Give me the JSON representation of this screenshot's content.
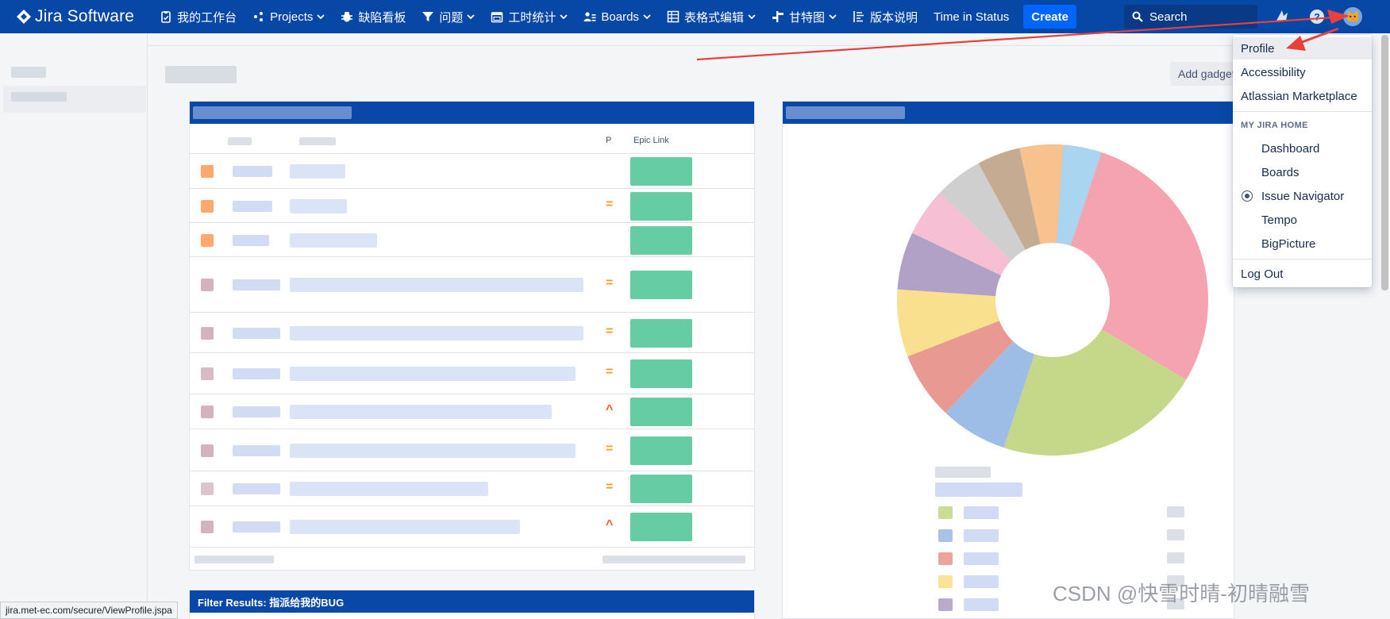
{
  "nav": {
    "logo_text": "Jira Software",
    "items": [
      {
        "label": "我的工作台",
        "icon": "clipboard-icon",
        "dropdown": false
      },
      {
        "label": "Projects",
        "icon": "projects-icon",
        "dropdown": true
      },
      {
        "label": "缺陷看板",
        "icon": "bug-icon",
        "dropdown": false
      },
      {
        "label": "问题",
        "icon": "filter-icon",
        "dropdown": true
      },
      {
        "label": "工时统计",
        "icon": "calendar-icon",
        "dropdown": true
      },
      {
        "label": "Boards",
        "icon": "people-icon",
        "dropdown": true
      },
      {
        "label": "表格式编辑",
        "icon": "table-icon",
        "dropdown": true
      },
      {
        "label": "甘特图",
        "icon": "gantt-icon",
        "dropdown": true
      },
      {
        "label": "版本说明",
        "icon": "release-notes-icon",
        "dropdown": false
      },
      {
        "label": "Time in Status",
        "icon": "",
        "dropdown": false
      }
    ],
    "create_label": "Create",
    "search_placeholder": "Search",
    "accent_color": "#0747a6",
    "create_color": "#0065ff"
  },
  "toolbar": {
    "add_gadget_label": "Add gadget"
  },
  "gadget_issues": {
    "columns": {
      "priority": "P",
      "epic_link": "Epic Link"
    },
    "rows": [
      {
        "priority": "",
        "priority_color": "#ffd99e"
      },
      {
        "priority": "=",
        "priority_color": "#ff991f"
      },
      {
        "priority": "",
        "priority_color": "#ffe9c7"
      },
      {
        "priority": "=",
        "priority_color": "#ff991f"
      },
      {
        "priority": "=",
        "priority_color": "#ff991f"
      },
      {
        "priority": "=",
        "priority_color": "#ff991f"
      },
      {
        "priority": "^",
        "priority_color": "#ff5630"
      },
      {
        "priority": "=",
        "priority_color": "#ff991f"
      },
      {
        "priority": "=",
        "priority_color": "#ff991f"
      },
      {
        "priority": "^",
        "priority_color": "#ff5630"
      }
    ]
  },
  "gadget_filter": {
    "title": "Filter Results: 指派给我的BUG"
  },
  "user_menu": {
    "items": [
      {
        "label": "Profile",
        "active": true
      },
      {
        "label": "Accessibility"
      },
      {
        "label": "Atlassian Marketplace"
      }
    ],
    "home_heading": "MY JIRA HOME",
    "home_items": [
      {
        "label": "Dashboard",
        "selected": false
      },
      {
        "label": "Boards",
        "selected": false
      },
      {
        "label": "Issue Navigator",
        "selected": true
      },
      {
        "label": "Tempo",
        "selected": false
      },
      {
        "label": "BigPicture",
        "selected": false
      }
    ],
    "logout_label": "Log Out"
  },
  "status_url": "jira.met-ec.com/secure/ViewProfile.jspa",
  "watermark": "CSDN @快雪时晴-初晴融雪",
  "colors": {
    "annotation_arrow": "#e8413c",
    "gadget_header": "#0a48a8"
  }
}
